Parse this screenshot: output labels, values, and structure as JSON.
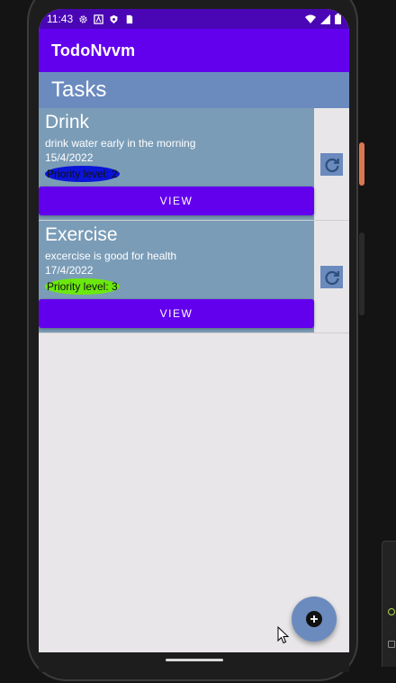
{
  "status_bar": {
    "time": "11:43",
    "left_icons": [
      "gear-icon",
      "a-icon",
      "shield-icon",
      "sim-card-icon"
    ],
    "right_icons": [
      "wifi-icon",
      "signal-icon",
      "battery-icon"
    ]
  },
  "app_bar": {
    "title": "TodoNvvm"
  },
  "tasks_header": {
    "title": "Tasks"
  },
  "tasks": [
    {
      "title": "Drink",
      "description": "drink water early in the morning",
      "date": "15/4/2022",
      "priority": "Priority level: 2",
      "priority_color": "#0a14d8",
      "view_label": "VIEW"
    },
    {
      "title": "Exercise",
      "description": "excercise is good for health",
      "date": "17/4/2022",
      "priority": "Priority level: 3",
      "priority_color": "#6be80e",
      "view_label": "VIEW"
    }
  ],
  "colors": {
    "status_bar": "#4a05b5",
    "primary": "#6200ee",
    "header": "#6b8bbf",
    "card": "#7a9cb7",
    "background": "#e8e6e8"
  }
}
